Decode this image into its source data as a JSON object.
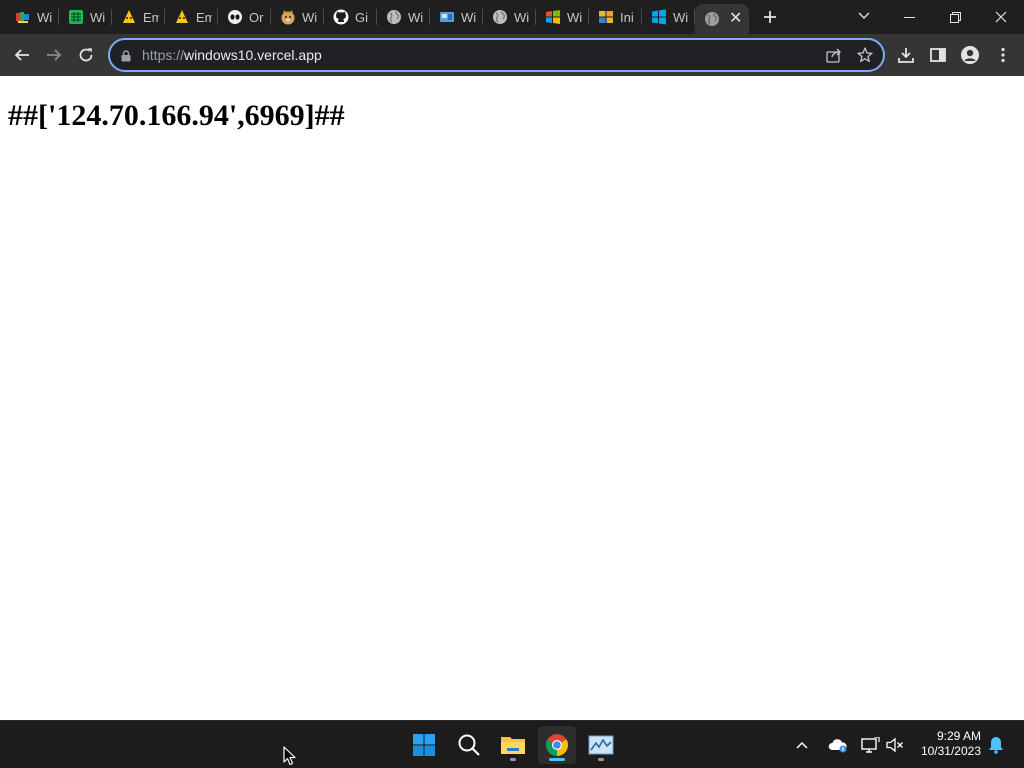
{
  "browser": {
    "tabs": [
      {
        "title": "Wi",
        "icon": "colorful-site-icon"
      },
      {
        "title": "Wi",
        "icon": "green-grid-icon"
      },
      {
        "title": "Em",
        "icon": "yellow-emoji-icon"
      },
      {
        "title": "Em",
        "icon": "yellow-emoji-icon"
      },
      {
        "title": "Or",
        "icon": "alien-mask-icon"
      },
      {
        "title": "Wi",
        "icon": "doge-icon"
      },
      {
        "title": "Gi",
        "icon": "github-icon"
      },
      {
        "title": "Wi",
        "icon": "globe-icon"
      },
      {
        "title": "Wi",
        "icon": "windows-window-icon"
      },
      {
        "title": "Wi",
        "icon": "globe-icon"
      },
      {
        "title": "Wi",
        "icon": "windows-xp-flag-icon"
      },
      {
        "title": "Ini",
        "icon": "windows-8-flag-icon"
      },
      {
        "title": "Wi",
        "icon": "windows-10-logo-icon"
      },
      {
        "title": "",
        "icon": "globe-icon",
        "active": true
      }
    ],
    "omnibox": {
      "scheme": "https://",
      "host": "windows10.vercel.app"
    }
  },
  "page": {
    "heading": "##['124.70.166.94',6969]##"
  },
  "taskbar": {
    "apps": [
      "start-button",
      "search-button",
      "file-explorer",
      "chrome",
      "task-manager"
    ],
    "clock": {
      "time": "9:29 AM",
      "date": "10/31/2023"
    }
  },
  "colors": {
    "accent": "#7cacf8",
    "taskbar_indicator": "#4cc2ff",
    "chrome_dark": "#1f1f1f",
    "toolbar": "#353535"
  }
}
